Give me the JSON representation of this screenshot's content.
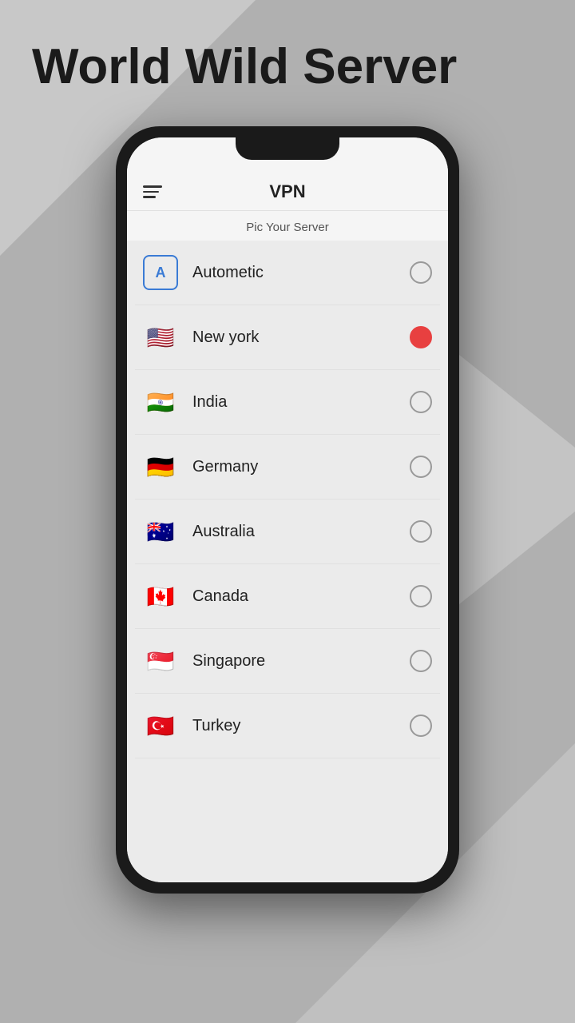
{
  "background": {
    "color": "#b5b5b5"
  },
  "page_title": "World Wild Server",
  "app": {
    "title": "VPN",
    "subtitle": "Pic Your Server",
    "menu_label": "Menu"
  },
  "servers": [
    {
      "id": "autometic",
      "name": "Autometic",
      "flag": "auto",
      "selected": false
    },
    {
      "id": "new-york",
      "name": "New york",
      "flag": "🇺🇸",
      "selected": true
    },
    {
      "id": "india",
      "name": "India",
      "flag": "🇮🇳",
      "selected": false
    },
    {
      "id": "germany",
      "name": "Germany",
      "flag": "🇩🇪",
      "selected": false
    },
    {
      "id": "australia",
      "name": "Australia",
      "flag": "🇦🇺",
      "selected": false
    },
    {
      "id": "canada",
      "name": "Canada",
      "flag": "🇨🇦",
      "selected": false
    },
    {
      "id": "singapore",
      "name": "Singapore",
      "flag": "🇸🇬",
      "selected": false
    },
    {
      "id": "turkey",
      "name": "Turkey",
      "flag": "🇹🇷",
      "selected": false
    }
  ]
}
